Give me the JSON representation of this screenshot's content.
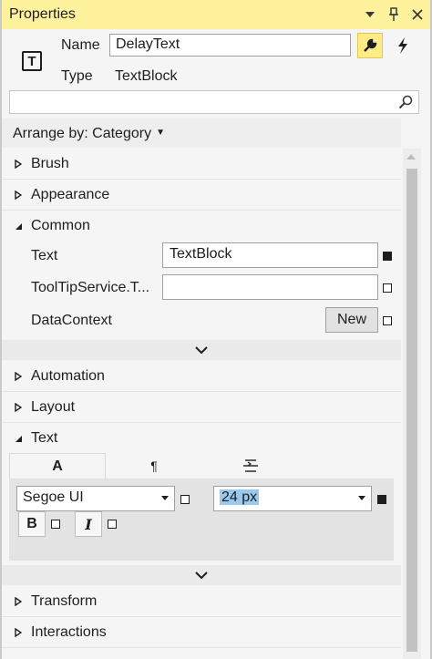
{
  "window": {
    "title": "Properties",
    "colors": {
      "titlebar": "#fff29d",
      "accent_selected": "#99c9ef",
      "active_tool": "#ffec88"
    },
    "icons": [
      "dropdown-icon",
      "pin-icon",
      "close-icon"
    ]
  },
  "header": {
    "name_label": "Name",
    "name_value": "DelayText",
    "type_label": "Type",
    "type_value": "TextBlock",
    "element_icon_glyph": "T",
    "search_placeholder": ""
  },
  "arrange": {
    "label": "Arrange by: Category"
  },
  "categories": {
    "brush": "Brush",
    "appearance": "Appearance",
    "common": "Common",
    "automation": "Automation",
    "layout": "Layout",
    "text": "Text",
    "transform": "Transform",
    "interactions": "Interactions"
  },
  "common_props": {
    "text_label": "Text",
    "text_value": "TextBlock",
    "tooltip_label": "ToolTipService.T...",
    "tooltip_value": "",
    "datacontext_label": "DataContext",
    "new_button": "New"
  },
  "text_section": {
    "tab_font_glyph": "A",
    "tab_paragraph_glyph": "¶",
    "font_family": "Segoe UI",
    "font_size": "24 px",
    "bold_glyph": "B",
    "italic_glyph": "I"
  }
}
